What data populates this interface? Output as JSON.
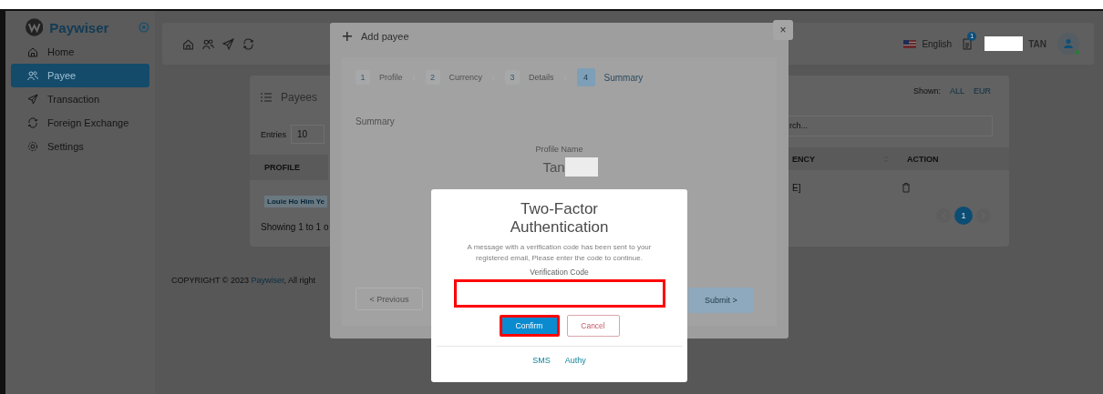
{
  "sidebar": {
    "brand": "Paywiser",
    "items": [
      {
        "label": "Home",
        "selected": false
      },
      {
        "label": "Payee",
        "selected": true
      },
      {
        "label": "Transaction",
        "selected": false
      },
      {
        "label": "Foreign Exchange",
        "selected": false
      },
      {
        "label": "Settings",
        "selected": false
      }
    ]
  },
  "header": {
    "language": "English",
    "notification_count": "1",
    "user_name": "TAN"
  },
  "payees_card": {
    "title": "Payees",
    "entries_label": "Entries",
    "entries_value": "10",
    "shown_label": "Shown:",
    "filters": [
      {
        "label": "ALL",
        "selected": false
      },
      {
        "label": "EUR",
        "selected": false
      }
    ],
    "search_placeholder": "rch...",
    "columns": [
      "PROFILE",
      "ENCY",
      "ACTION"
    ],
    "rows": [
      {
        "profile": "Louie Ho Him Ye",
        "column_2": "E]"
      }
    ],
    "footer": "Showing 1 to 1 o",
    "pages": [
      {
        "label": "1",
        "selected": true
      }
    ]
  },
  "copyright": {
    "prefix": "COPYRIGHT © 2023 ",
    "link": "Paywiser",
    "suffix": ", All right"
  },
  "add_payee_modal": {
    "title": "Add payee",
    "close": "×",
    "steps": [
      {
        "number": "1",
        "label": "Profile",
        "selected": false
      },
      {
        "number": "2",
        "label": "Currency",
        "selected": false
      },
      {
        "number": "3",
        "label": "Details",
        "selected": false
      },
      {
        "number": "4",
        "label": "Summary",
        "selected": true
      }
    ],
    "section_title": "Summary",
    "field_label": "Profile Name",
    "field_value": "Tan",
    "previous_button": "< Previous",
    "submit_button": "Submit >"
  },
  "two_factor_dialog": {
    "title": "Two-Factor Authentication",
    "message": "A message with a verification code has been sent to your registered email, Please enter the code to continue.",
    "field_label": "Verification Code",
    "field_highlighted": true,
    "buttons": [
      {
        "label": "Confirm",
        "kind": "primary",
        "highlighted": true
      },
      {
        "label": "Cancel",
        "kind": "secondary",
        "highlighted": false
      }
    ],
    "methods": [
      "SMS",
      "Authy"
    ]
  }
}
